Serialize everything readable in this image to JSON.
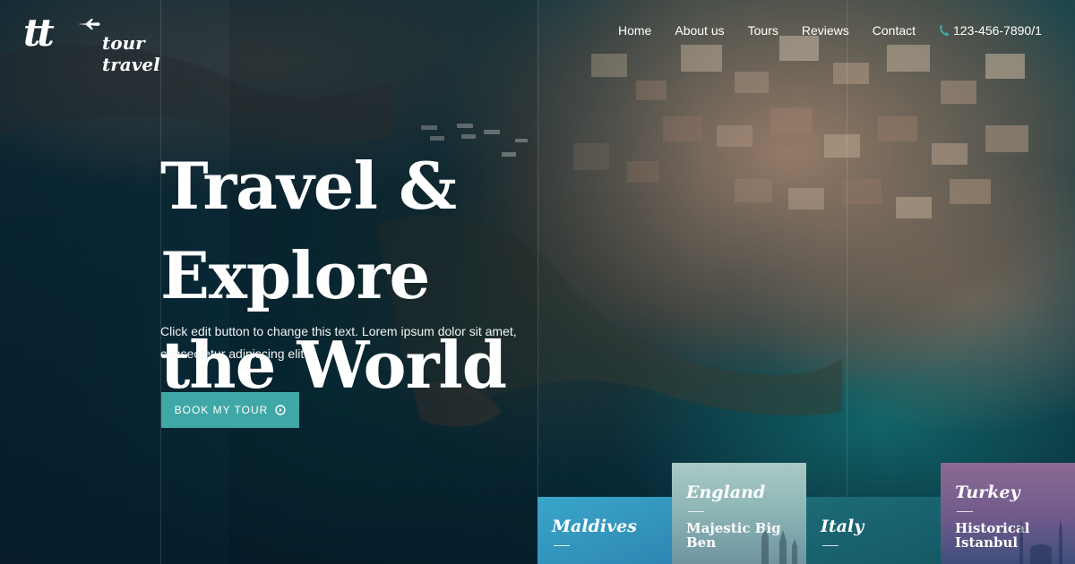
{
  "brand": {
    "logo_mark": "tt",
    "logo_word": "tour travel"
  },
  "nav": {
    "items": [
      "Home",
      "About us",
      "Tours",
      "Reviews",
      "Contact"
    ],
    "phone": "123-456-7890/1",
    "phone_icon": "phone-icon"
  },
  "hero": {
    "title_line1": "Travel & Explore",
    "title_line2": "the World",
    "text": "Click edit button to change this text. Lorem ipsum dolor sit amet, consectetur adipiscing elit.",
    "button_label": "BOOK MY TOUR",
    "button_icon": "arrow-circle-icon"
  },
  "cards": [
    {
      "country": "Maldives",
      "title": ""
    },
    {
      "country": "England",
      "title": "Majestic Big Ben"
    },
    {
      "country": "Italy",
      "title": ""
    },
    {
      "country": "Turkey",
      "title": "Historical Istanbul"
    }
  ],
  "colors": {
    "accent": "#3fa7a5",
    "maldives": "#3aa6c9",
    "england": "#8eb7b7",
    "italy": "#1c6c77",
    "turkey": "#6f5a8c"
  }
}
